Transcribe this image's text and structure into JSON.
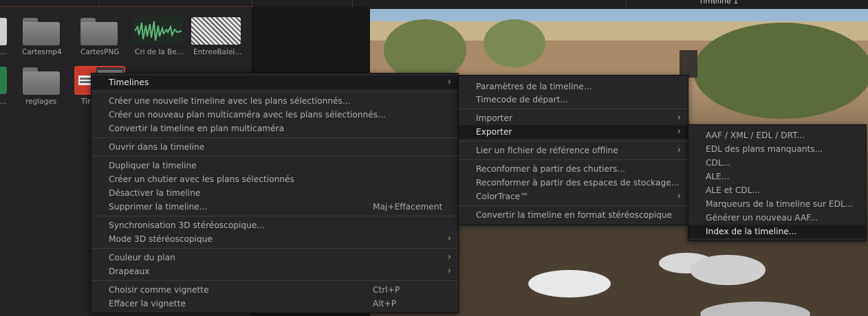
{
  "viewer": {
    "title": "Timeline 1"
  },
  "media_pool": {
    "row1": [
      "...",
      "Cartesmp4",
      "CartesPNG",
      "Cri de la Be...",
      "EntreeBalei..."
    ],
    "row2": [
      "...",
      "reglages",
      "Tim"
    ]
  },
  "menu_main": {
    "items": [
      {
        "label": "Timelines",
        "arrow": "›"
      },
      {
        "label": "Créer une nouvelle timeline avec les plans sélectionnés..."
      },
      {
        "label": "Créer un nouveau plan multicaméra avec les plans sélectionnés..."
      },
      {
        "label": "Convertir la timeline en plan multicaméra"
      },
      {
        "label": "Ouvrir dans la timeline"
      },
      {
        "label": "Dupliquer la timeline"
      },
      {
        "label": "Créer un chutier avec les plans sélectionnés"
      },
      {
        "label": "Désactiver la timeline"
      },
      {
        "label": "Supprimer la timeline...",
        "shortcut": "Maj+Effacement"
      },
      {
        "label": "Synchronisation 3D stéréoscopique..."
      },
      {
        "label": "Mode 3D stéréoscopique",
        "arrow": "›"
      },
      {
        "label": "Couleur du plan",
        "arrow": "›"
      },
      {
        "label": "Drapeaux",
        "arrow": "›"
      },
      {
        "label": "Choisir comme vignette",
        "shortcut": "Ctrl+P"
      },
      {
        "label": "Effacer la vignette",
        "shortcut": "Alt+P"
      }
    ]
  },
  "menu_timelines": {
    "items": [
      {
        "label": "Paramètres de la timeline..."
      },
      {
        "label": "Timecode de départ..."
      },
      {
        "label": "Importer",
        "arrow": "›"
      },
      {
        "label": "Exporter",
        "arrow": "›"
      },
      {
        "label": "Lier un fichier de référence offline",
        "arrow": "›"
      },
      {
        "label": "Reconformer à partir des chutiers..."
      },
      {
        "label": "Reconformer à partir des espaces de stockage..."
      },
      {
        "label": "ColorTrace™",
        "arrow": "›"
      },
      {
        "label": "Convertir la timeline en format stéréoscopique"
      }
    ]
  },
  "menu_exporter": {
    "items": [
      {
        "label": "AAF / XML / EDL / DRT..."
      },
      {
        "label": "EDL des plans manquants..."
      },
      {
        "label": "CDL..."
      },
      {
        "label": "ALE..."
      },
      {
        "label": "ALE et CDL..."
      },
      {
        "label": "Marqueurs de la timeline sur EDL..."
      },
      {
        "label": "Générer un nouveau AAF..."
      },
      {
        "label": "Index de la timeline..."
      }
    ]
  },
  "colors": {
    "accent_red": "#d9392b",
    "menu_bg": "#262628",
    "highlight_bg": "#1a1a1c"
  }
}
